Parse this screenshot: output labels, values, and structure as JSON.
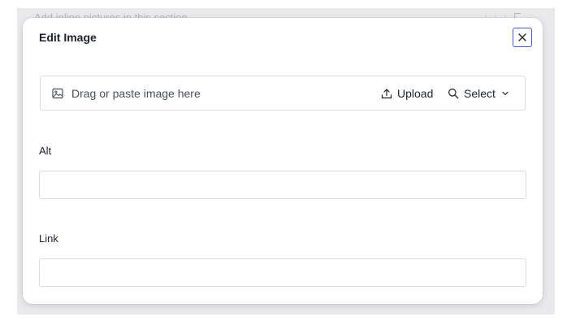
{
  "background": {
    "hint_text": "Add inline pictures in this section",
    "icons": [
      "more-icon",
      "insert-icon"
    ]
  },
  "modal": {
    "title": "Edit Image",
    "close_icon": "close-icon",
    "dropzone": {
      "icon": "image-icon",
      "text": "Drag or paste image here",
      "upload_label": "Upload",
      "upload_icon": "upload-icon",
      "select_label": "Select",
      "select_icon": "search-icon",
      "select_chevron": "chevron-down-icon"
    },
    "fields": [
      {
        "label": "Alt",
        "value": "",
        "placeholder": ""
      },
      {
        "label": "Link",
        "value": "",
        "placeholder": ""
      }
    ]
  },
  "colors": {
    "accent": "#4a5bc4",
    "backdrop": "#e9e9ec",
    "border": "#dcdcdf",
    "text": "#1f2328"
  }
}
